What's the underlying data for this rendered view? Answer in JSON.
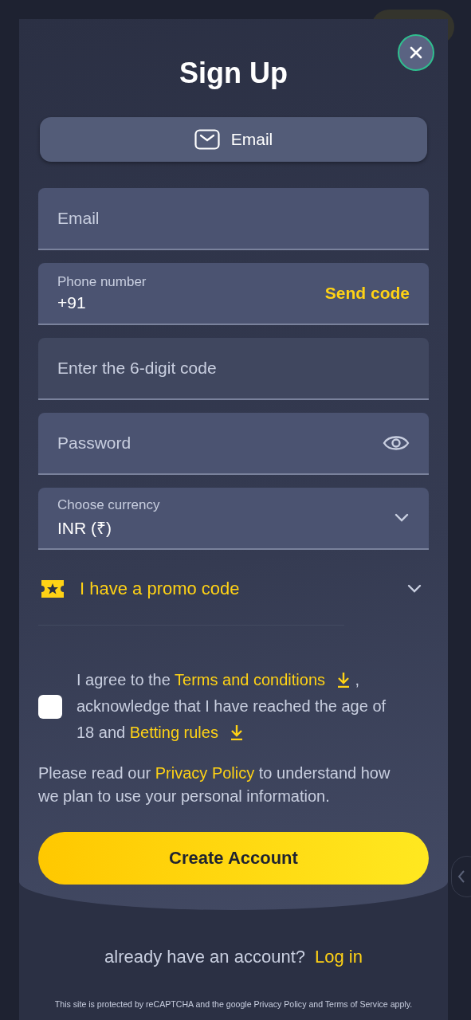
{
  "title": "Sign Up",
  "method_tabs": [
    {
      "label": "Email",
      "selected": true
    }
  ],
  "fields": [
    {
      "kind": "text",
      "placeholder": "Email",
      "disabled": false
    },
    {
      "kind": "phone",
      "label": "Phone number",
      "value": "+91",
      "action": "Send code"
    },
    {
      "kind": "text",
      "placeholder": "Enter the 6-digit code",
      "disabled": true
    },
    {
      "kind": "password",
      "placeholder": "Password",
      "disabled": false
    },
    {
      "kind": "select",
      "label": "Choose currency",
      "value": "INR (₹)"
    }
  ],
  "promo": {
    "label": "I have a promo code",
    "expanded": false
  },
  "agreement": {
    "checked": false,
    "segments": [
      {
        "kind": "text",
        "text": "I agree to the "
      },
      {
        "kind": "link",
        "text": "Terms and conditions",
        "download": true
      },
      {
        "kind": "text",
        "text": " , acknowledge that I have reached the age of 18 and "
      },
      {
        "kind": "link",
        "text": "Betting rules",
        "download": true
      }
    ]
  },
  "privacy": {
    "segments": [
      {
        "kind": "text",
        "text": "Please read our "
      },
      {
        "kind": "link",
        "text": "Privacy Policy",
        "download": false
      },
      {
        "kind": "text",
        "text": " to understand how we plan to use your personal information."
      }
    ]
  },
  "submit": "Create Account",
  "login_prompt": {
    "text": "already have an account?",
    "link": "Log in"
  },
  "recaptcha_note": "This site is protected by reCAPTCHA and the google Privacy Policy and Terms of Service apply."
}
